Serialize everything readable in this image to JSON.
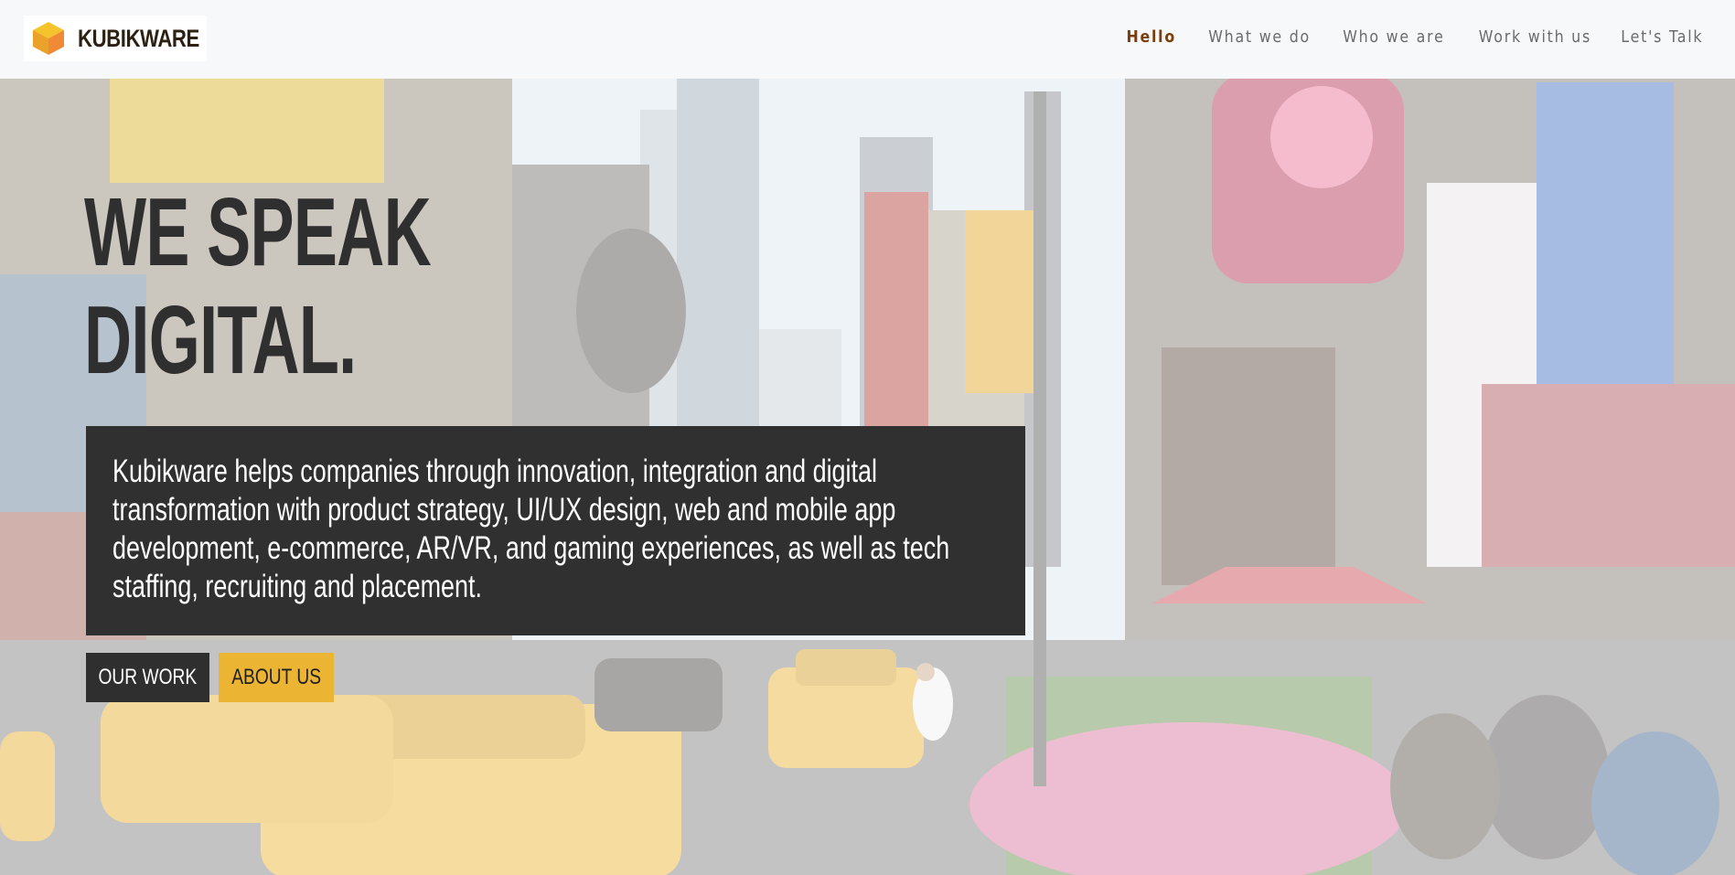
{
  "header": {
    "brand_name": "KUBIKWARE",
    "logo_icon": "cube-icon",
    "colors": {
      "background": "#f7f8f9",
      "nav_active": "#7a3f0c",
      "nav_default": "#6b6b6b"
    },
    "nav": [
      {
        "label": "Hello",
        "active": true
      },
      {
        "label": "What we do",
        "active": false
      },
      {
        "label": "Who we are",
        "active": false
      },
      {
        "label": "Work with us",
        "active": false
      },
      {
        "label": "Let's Talk",
        "active": false
      }
    ]
  },
  "hero": {
    "title_line1": "WE SPEAK",
    "title_line2": "DIGITAL.",
    "tagline": "Kubikware helps companies through innovation, integration and digital transformation with product strategy, UI/UX design, web and mobile app development, e-commerce, AR/VR, and gaming experiences, as well as tech staffing, recruiting and placement.",
    "background_image": "faded city street scene with yellow taxis",
    "buttons": {
      "our_work": "OUR WORK",
      "about_us": "ABOUT US"
    },
    "colors": {
      "title": "#2f2f2f",
      "tagline_bg": "#303030",
      "primary_button": "#2f2f2f",
      "accent_button": "#ebb432"
    }
  }
}
